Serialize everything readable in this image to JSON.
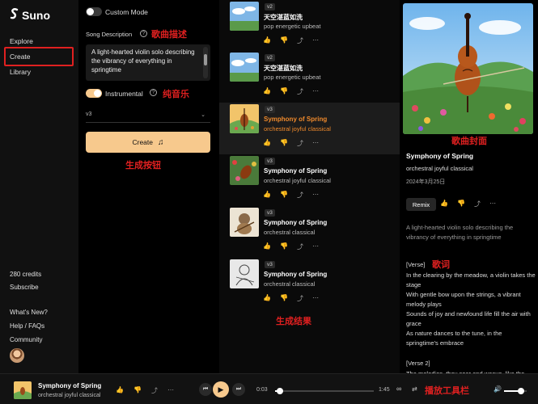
{
  "app": {
    "name": "Suno"
  },
  "sidebar": {
    "nav": [
      {
        "label": "Explore"
      },
      {
        "label": "Create"
      },
      {
        "label": "Library"
      }
    ],
    "credits": "280 credits",
    "subscribe": "Subscribe",
    "whats_new": "What's New?",
    "help": "Help / FAQs",
    "community": "Community"
  },
  "create": {
    "custom_mode": "Custom Mode",
    "song_description_label": "Song Description",
    "song_description": "A light-hearted violin solo describing the vibrancy of everything in springtime",
    "instrumental_label": "Instrumental",
    "instrumental_on": true,
    "version": "v3",
    "create_button": "Create",
    "annotations": {
      "description": "歌曲描述",
      "instrumental": "纯音乐",
      "create_button": "生成按钮"
    }
  },
  "songs": [
    {
      "version": "v2",
      "title": "天空湛蓝如洗",
      "genre": "pop energetic upbeat",
      "selected": false
    },
    {
      "version": "v2",
      "title": "天空湛蓝如洗",
      "genre": "pop energetic upbeat",
      "selected": false
    },
    {
      "version": "v3",
      "title": "Symphony of Spring",
      "genre": "orchestral joyful classical",
      "selected": true
    },
    {
      "version": "v3",
      "title": "Symphony of Spring",
      "genre": "orchestral joyful classical",
      "selected": false
    },
    {
      "version": "v3",
      "title": "Symphony of Spring",
      "genre": "orchestral classical",
      "selected": false
    },
    {
      "version": "v3",
      "title": "Symphony of Spring",
      "genre": "orchestral classical",
      "selected": false
    }
  ],
  "list_annotation": "生成结果",
  "detail": {
    "cover_annotation": "歌曲封面",
    "title": "Symphony of Spring",
    "genre": "orchestral joyful classical",
    "date": "2024年3月25日",
    "remix": "Remix",
    "description": "A light-hearted violin solo describing the vibrancy of everything in springtime",
    "lyrics_annotation": "歌词",
    "lyrics": [
      "[Verse]",
      "In the clearing by the meadow, a violin takes the stage",
      "With gentle bow upon the strings, a vibrant melody plays",
      "Sounds of joy and newfound life fill the air with grace",
      "As nature dances to the tune, in the springtime's embrace",
      "",
      "[Verse 2]",
      "The melodies, they soar and weave, like the..."
    ]
  },
  "player": {
    "title": "Symphony of Spring",
    "genre": "orchestral joyful classical",
    "current": "0:03",
    "duration": "1:45",
    "progress": 0.03,
    "volume": 0.75,
    "annotation": "播放工具栏"
  },
  "colors": {
    "accent": "#f7c98d",
    "highlight": "#f08a2c",
    "annotation": "#e02020"
  }
}
